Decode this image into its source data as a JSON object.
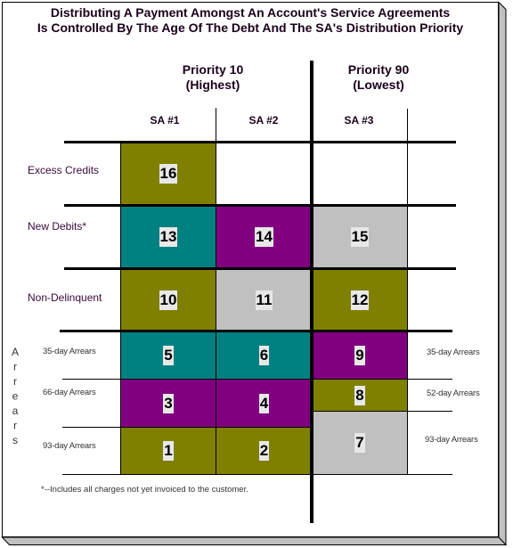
{
  "title": {
    "line1": "Distributing A Payment Amongst An Account's Service Agreements",
    "line2": "Is Controlled By The Age Of The Debt And The SA's Distribution Priority"
  },
  "priority_groups": [
    {
      "name": "Priority 10",
      "rank": "(Highest)"
    },
    {
      "name": "Priority 90",
      "rank": "(Lowest)"
    }
  ],
  "service_agreements": [
    "SA #1",
    "SA #2",
    "SA #3"
  ],
  "debt_categories": [
    "Excess Credits",
    "New Debits*",
    "Non-Delinquent"
  ],
  "arrears": {
    "title": "Arrears",
    "left_labels": [
      "35-day Arrears",
      "66-day Arrears",
      "93-day Arrears"
    ],
    "right_labels": [
      "35-day Arrears",
      "52-day Arrears",
      "93-day Arrears"
    ]
  },
  "palette": {
    "olive": "#808000",
    "teal": "#008080",
    "purple": "#800080",
    "silver": "#c0c0c0"
  },
  "cells": [
    {
      "sa": "SA #1",
      "bucket": "Excess Credits",
      "order": "16",
      "color": "olive"
    },
    {
      "sa": "SA #1",
      "bucket": "New Debits*",
      "order": "13",
      "color": "teal"
    },
    {
      "sa": "SA #2",
      "bucket": "New Debits*",
      "order": "14",
      "color": "purple"
    },
    {
      "sa": "SA #3",
      "bucket": "New Debits*",
      "order": "15",
      "color": "silver"
    },
    {
      "sa": "SA #1",
      "bucket": "Non-Delinquent",
      "order": "10",
      "color": "olive"
    },
    {
      "sa": "SA #2",
      "bucket": "Non-Delinquent",
      "order": "11",
      "color": "silver"
    },
    {
      "sa": "SA #3",
      "bucket": "Non-Delinquent",
      "order": "12",
      "color": "olive"
    },
    {
      "sa": "SA #1",
      "bucket": "35-day Arrears",
      "order": "5",
      "color": "teal"
    },
    {
      "sa": "SA #2",
      "bucket": "35-day Arrears",
      "order": "6",
      "color": "teal"
    },
    {
      "sa": "SA #3",
      "bucket": "35-day Arrears",
      "order": "9",
      "color": "purple"
    },
    {
      "sa": "SA #1",
      "bucket": "66-day Arrears",
      "order": "3",
      "color": "purple"
    },
    {
      "sa": "SA #2",
      "bucket": "66-day Arrears",
      "order": "4",
      "color": "purple"
    },
    {
      "sa": "SA #3",
      "bucket": "52-day Arrears",
      "order": "8",
      "color": "olive"
    },
    {
      "sa": "SA #1",
      "bucket": "93-day Arrears",
      "order": "1",
      "color": "olive"
    },
    {
      "sa": "SA #2",
      "bucket": "93-day Arrears",
      "order": "2",
      "color": "olive"
    },
    {
      "sa": "SA #3",
      "bucket": "93-day Arrears",
      "order": "7",
      "color": "silver"
    }
  ],
  "footnote": "*--Includes all charges not yet invoiced to the customer."
}
